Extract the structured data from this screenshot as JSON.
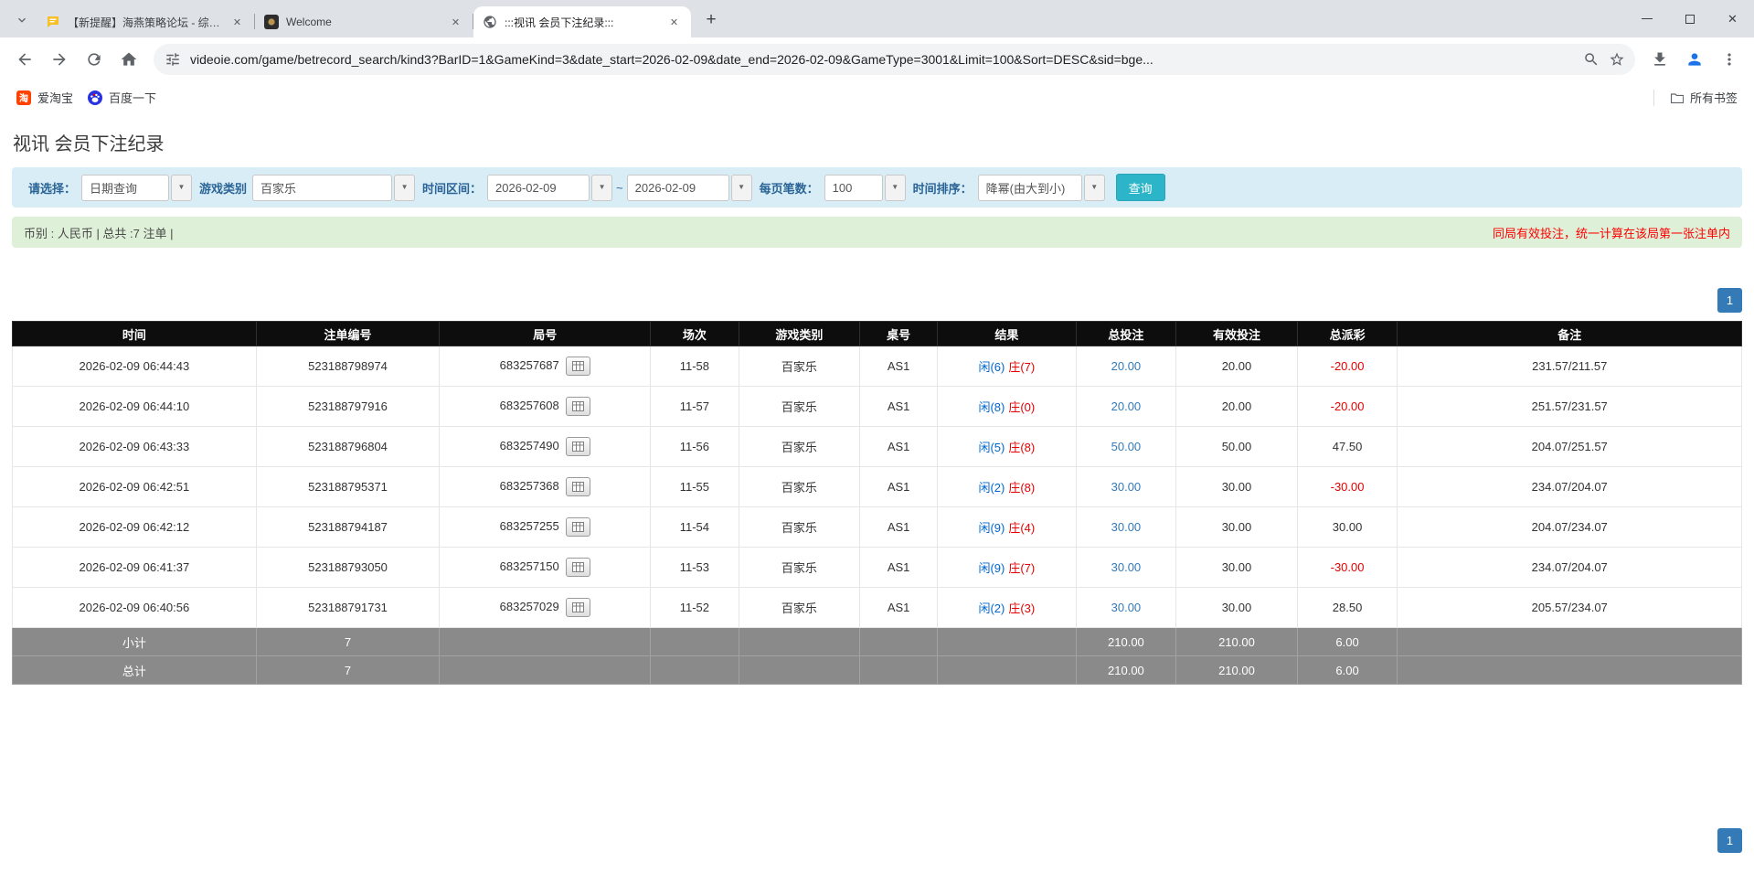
{
  "icons": {
    "close": "✕",
    "plus": "+",
    "chevron": "▼",
    "taobao_glyph": "淘"
  },
  "browser": {
    "tabs": [
      {
        "title": "【新提醒】海燕策略论坛 - 综合..."
      },
      {
        "title": "Welcome"
      },
      {
        "title": ":::视讯 会员下注纪录:::"
      }
    ],
    "url": "videoie.com/game/betrecord_search/kind3?BarID=1&GameKind=3&date_start=2026-02-09&date_end=2026-02-09&GameType=3001&Limit=100&Sort=DESC&sid=bge...",
    "bookmarks": [
      {
        "label": "爱淘宝"
      },
      {
        "label": "百度一下"
      }
    ],
    "all_bookmarks_label": "所有书签"
  },
  "page": {
    "title": "视讯 会员下注纪录",
    "filters": {
      "select_label": "请选择：",
      "select_value": "日期查询",
      "game_label": "游戏类别",
      "game_value": "百家乐",
      "range_label": "时间区间：",
      "date_start": "2026-02-09",
      "separator": "~",
      "date_end": "2026-02-09",
      "per_page_label": "每页笔数：",
      "per_page_value": "100",
      "sort_label": "时间排序：",
      "sort_value": "降幂(由大到小)",
      "search_button": "查询"
    },
    "summary": {
      "left": "币别 : 人民币 | 总共 :7 注单 |",
      "right": "同局有效投注，统一计算在该局第一张注单内"
    },
    "pagination": {
      "current": "1"
    },
    "table": {
      "headers": [
        "时间",
        "注单编号",
        "局号",
        "场次",
        "游戏类别",
        "桌号",
        "结果",
        "总投注",
        "有效投注",
        "总派彩",
        "备注"
      ],
      "rows": [
        {
          "time": "2026-02-09 06:44:43",
          "bet_id": "523188798974",
          "round_id": "683257687",
          "session": "11-58",
          "game": "百家乐",
          "table_no": "AS1",
          "result_player": "闲(6)",
          "result_banker": "庄(7)",
          "total_bet": "20.00",
          "valid_bet": "20.00",
          "payout": "-20.00",
          "note": "231.57/211.57"
        },
        {
          "time": "2026-02-09 06:44:10",
          "bet_id": "523188797916",
          "round_id": "683257608",
          "session": "11-57",
          "game": "百家乐",
          "table_no": "AS1",
          "result_player": "闲(8)",
          "result_banker": "庄(0)",
          "total_bet": "20.00",
          "valid_bet": "20.00",
          "payout": "-20.00",
          "note": "251.57/231.57"
        },
        {
          "time": "2026-02-09 06:43:33",
          "bet_id": "523188796804",
          "round_id": "683257490",
          "session": "11-56",
          "game": "百家乐",
          "table_no": "AS1",
          "result_player": "闲(5)",
          "result_banker": "庄(8)",
          "total_bet": "50.00",
          "valid_bet": "50.00",
          "payout": "47.50",
          "note": "204.07/251.57"
        },
        {
          "time": "2026-02-09 06:42:51",
          "bet_id": "523188795371",
          "round_id": "683257368",
          "session": "11-55",
          "game": "百家乐",
          "table_no": "AS1",
          "result_player": "闲(2)",
          "result_banker": "庄(8)",
          "total_bet": "30.00",
          "valid_bet": "30.00",
          "payout": "-30.00",
          "note": "234.07/204.07"
        },
        {
          "time": "2026-02-09 06:42:12",
          "bet_id": "523188794187",
          "round_id": "683257255",
          "session": "11-54",
          "game": "百家乐",
          "table_no": "AS1",
          "result_player": "闲(9)",
          "result_banker": "庄(4)",
          "total_bet": "30.00",
          "valid_bet": "30.00",
          "payout": "30.00",
          "note": "204.07/234.07"
        },
        {
          "time": "2026-02-09 06:41:37",
          "bet_id": "523188793050",
          "round_id": "683257150",
          "session": "11-53",
          "game": "百家乐",
          "table_no": "AS1",
          "result_player": "闲(9)",
          "result_banker": "庄(7)",
          "total_bet": "30.00",
          "valid_bet": "30.00",
          "payout": "-30.00",
          "note": "234.07/204.07"
        },
        {
          "time": "2026-02-09 06:40:56",
          "bet_id": "523188791731",
          "round_id": "683257029",
          "session": "11-52",
          "game": "百家乐",
          "table_no": "AS1",
          "result_player": "闲(2)",
          "result_banker": "庄(3)",
          "total_bet": "30.00",
          "valid_bet": "30.00",
          "payout": "28.50",
          "note": "205.57/234.07"
        }
      ],
      "footer_rows": [
        {
          "label": "小计",
          "count": "7",
          "total_bet": "210.00",
          "valid_bet": "210.00",
          "payout": "6.00"
        },
        {
          "label": "总计",
          "count": "7",
          "total_bet": "210.00",
          "valid_bet": "210.00",
          "payout": "6.00"
        }
      ]
    }
  }
}
